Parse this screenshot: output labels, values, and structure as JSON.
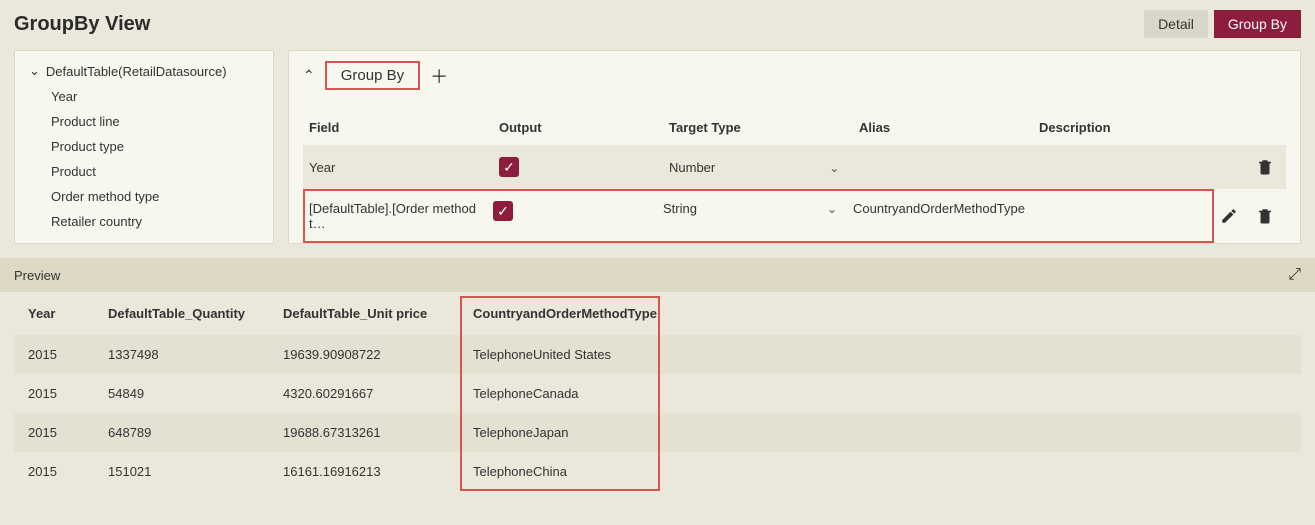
{
  "header": {
    "title": "GroupBy View"
  },
  "toggle": {
    "detail": "Detail",
    "groupby": "Group By"
  },
  "tree": {
    "root": "DefaultTable(RetailDatasource)",
    "items": [
      "Year",
      "Product line",
      "Product type",
      "Product",
      "Order method type",
      "Retailer country"
    ]
  },
  "config": {
    "chip": "Group By",
    "columns": {
      "field": "Field",
      "output": "Output",
      "target": "Target Type",
      "alias": "Alias",
      "desc": "Description"
    },
    "rows": [
      {
        "field": "Year",
        "output": true,
        "target": "Number",
        "alias": "",
        "desc": ""
      },
      {
        "field": "[DefaultTable].[Order method t…",
        "output": true,
        "target": "String",
        "alias": "CountryandOrderMethodType",
        "desc": ""
      }
    ]
  },
  "preview": {
    "label": "Preview",
    "columns": [
      "Year",
      "DefaultTable_Quantity",
      "DefaultTable_Unit price",
      "CountryandOrderMethodType"
    ],
    "rows": [
      {
        "c0": "2015",
        "c1": "1337498",
        "c2": "19639.90908722",
        "c3": "TelephoneUnited States"
      },
      {
        "c0": "2015",
        "c1": "54849",
        "c2": "4320.60291667",
        "c3": "TelephoneCanada"
      },
      {
        "c0": "2015",
        "c1": "648789",
        "c2": "19688.67313261",
        "c3": "TelephoneJapan"
      },
      {
        "c0": "2015",
        "c1": "151021",
        "c2": "16161.16916213",
        "c3": "TelephoneChina"
      }
    ]
  }
}
